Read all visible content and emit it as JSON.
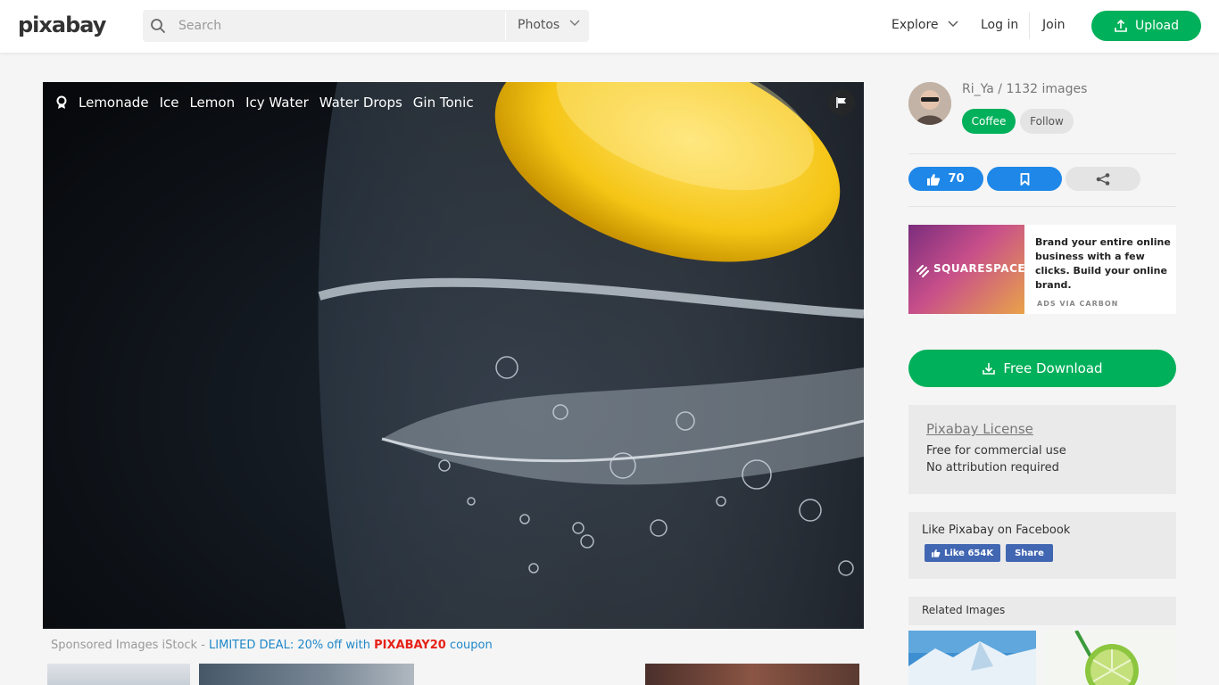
{
  "header": {
    "logo": "pixabay",
    "search_placeholder": "Search",
    "search_type": "Photos",
    "explore": "Explore",
    "login": "Log in",
    "join": "Join",
    "upload": "Upload"
  },
  "image": {
    "tags": [
      "Lemonade",
      "Ice",
      "Lemon",
      "Icy Water",
      "Water Drops",
      "Gin Tonic"
    ]
  },
  "sponsored": {
    "prefix": "Sponsored Images iStock - ",
    "deal": "LIMITED DEAL: 20% off with ",
    "code": "PIXABAY20",
    "suffix": " coupon"
  },
  "sidebar": {
    "author": "Ri_Ya / 1132 images",
    "coffee": "Coffee",
    "follow": "Follow",
    "likes": "70",
    "ad": {
      "brand": "SQUARESPACE",
      "text": "Brand your entire online business with a few clicks. Build your online brand.",
      "via": "ADS VIA CARBON"
    },
    "download": "Free Download",
    "license": {
      "title": "Pixabay License",
      "line1": "Free for commercial use",
      "line2": "No attribution required"
    },
    "facebook": {
      "title": "Like Pixabay on Facebook",
      "like": "Like 654K",
      "share": "Share"
    },
    "related": "Related Images"
  },
  "colors": {
    "brand_green": "#00b05a",
    "like_blue": "#1e87e8",
    "deal_blue": "#1e87c8",
    "code_red": "#e62117"
  }
}
